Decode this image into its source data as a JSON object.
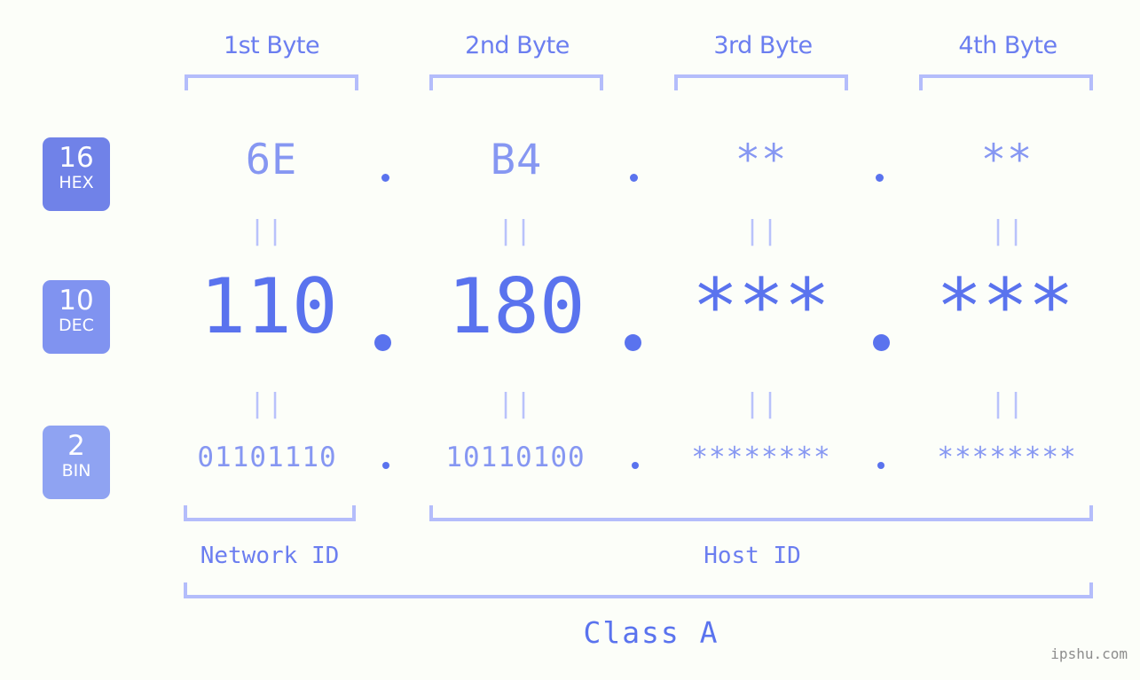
{
  "background_color": "#fcfef9",
  "accent_color": "#5a73ee",
  "light_accent_color": "#8697f2",
  "bracket_color": "#b4bdfb",
  "headers": [
    {
      "label": "1st Byte"
    },
    {
      "label": "2nd Byte"
    },
    {
      "label": "3rd Byte"
    },
    {
      "label": "4th Byte"
    }
  ],
  "bases": [
    {
      "number": "16",
      "abbr": "HEX",
      "color": "#7082e8"
    },
    {
      "number": "10",
      "abbr": "DEC",
      "color": "#8093f0"
    },
    {
      "number": "2",
      "abbr": "BIN",
      "color": "#8fa3f2"
    }
  ],
  "rows": {
    "hex": {
      "octets": [
        "6E",
        "B4",
        "**",
        "**"
      ]
    },
    "dec": {
      "octets": [
        "110",
        "180",
        "***",
        "***"
      ]
    },
    "bin": {
      "octets": [
        "01101110",
        "10110100",
        "********",
        "********"
      ]
    }
  },
  "separators": {
    "dot": ".",
    "equals": "||"
  },
  "sections": {
    "network_id": "Network ID",
    "host_id": "Host ID",
    "class": "Class A"
  },
  "watermark": "ipshu.com"
}
